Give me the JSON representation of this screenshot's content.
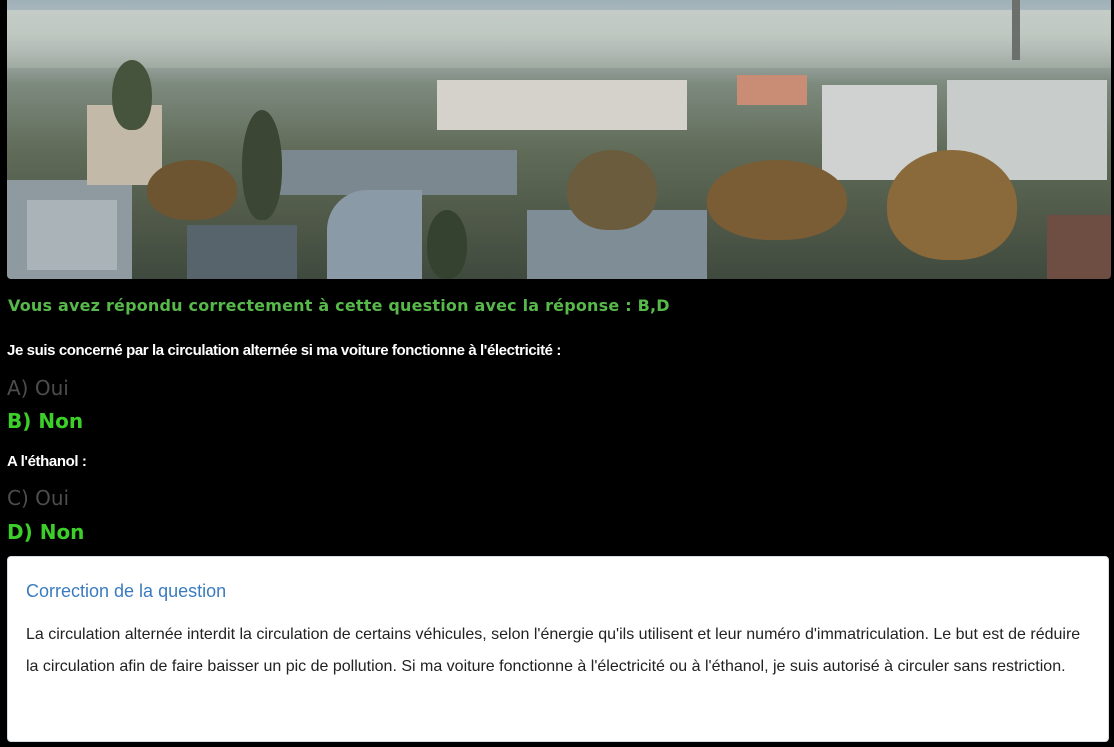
{
  "hero": {
    "image_description_icon": "city-photo"
  },
  "result_text": "Vous avez répondu correctement à cette question avec la réponse : B,D",
  "questions": [
    {
      "text": "Je suis concerné par la circulation alternée si ma voiture fonctionne à l'électricité :",
      "answers": [
        {
          "label": "A) Oui",
          "state": "wrong"
        },
        {
          "label": "B) Non",
          "state": "correct"
        }
      ]
    },
    {
      "text": "A l'éthanol :",
      "answers": [
        {
          "label": "C) Oui",
          "state": "wrong"
        },
        {
          "label": "D) Non",
          "state": "correct"
        }
      ]
    }
  ],
  "correction": {
    "title": "Correction de la question",
    "text": "La circulation alternée interdit la circulation de certains véhicules, selon l'énergie qu'ils utilisent et leur numéro d'immatriculation. Le but est de réduire la circulation afin de faire baisser un pic de pollution. Si ma voiture fonctionne à l'électricité ou à l'éthanol, je suis autorisé à circuler sans restriction."
  },
  "colors": {
    "correct": "#3ccf2a",
    "result": "#57b94a",
    "wrong": "#4d4d4d",
    "correction_title": "#3a7bbf",
    "background": "#000000"
  }
}
